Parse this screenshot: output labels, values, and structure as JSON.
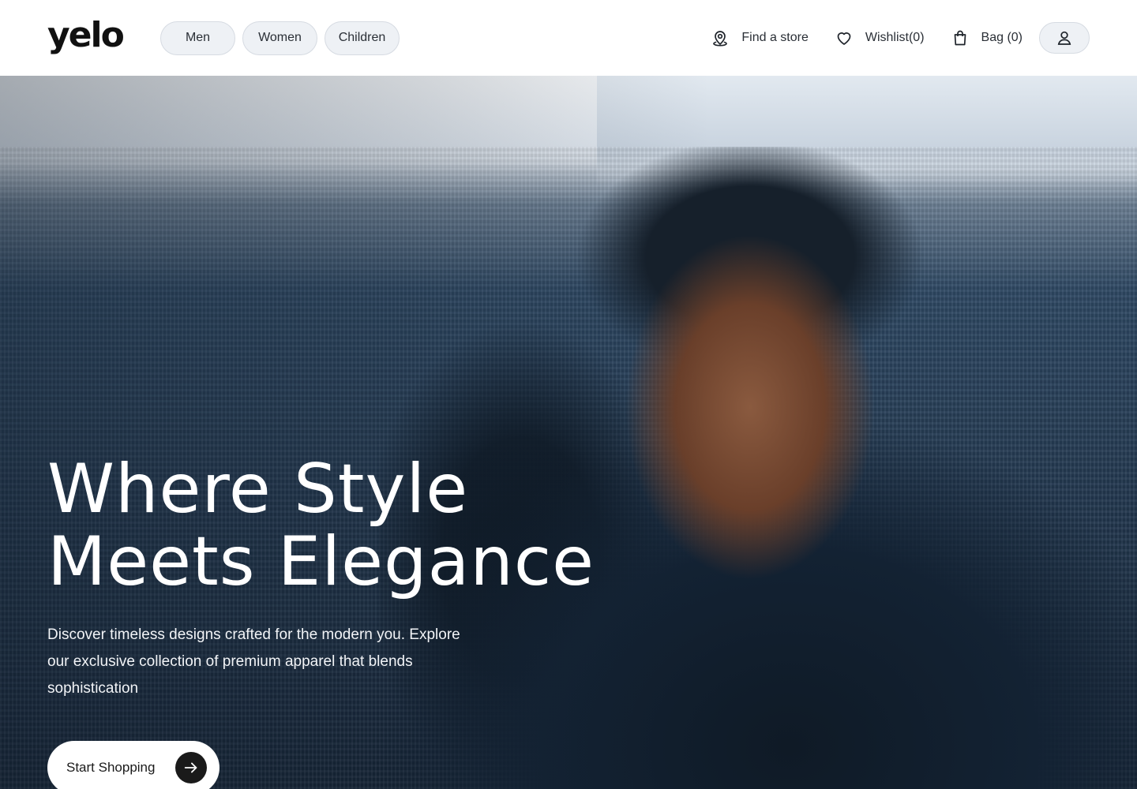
{
  "brand": {
    "logo_text": "yelo"
  },
  "nav": {
    "pills": [
      {
        "label": "Men"
      },
      {
        "label": "Women"
      },
      {
        "label": "Children"
      }
    ]
  },
  "header_actions": {
    "find_store": {
      "label": "Find a store",
      "icon": "location-pin-icon"
    },
    "wishlist": {
      "label": "Wishlist(0)",
      "icon": "heart-icon"
    },
    "bag": {
      "label": "Bag (0)",
      "icon": "shopping-bag-icon"
    },
    "profile": {
      "icon": "user-icon"
    }
  },
  "hero": {
    "title": "Where Style\nMeets Elegance",
    "subtitle": "Discover timeless designs crafted for the modern you. Explore our exclusive collection of premium apparel that blends sophistication",
    "cta_label": "Start Shopping",
    "cta_icon": "arrow-right-icon"
  },
  "colors": {
    "pill_bg": "#eef1f5",
    "pill_border": "#d6dbe2",
    "text_dark": "#1a1a1a",
    "hero_text": "#ffffff"
  }
}
